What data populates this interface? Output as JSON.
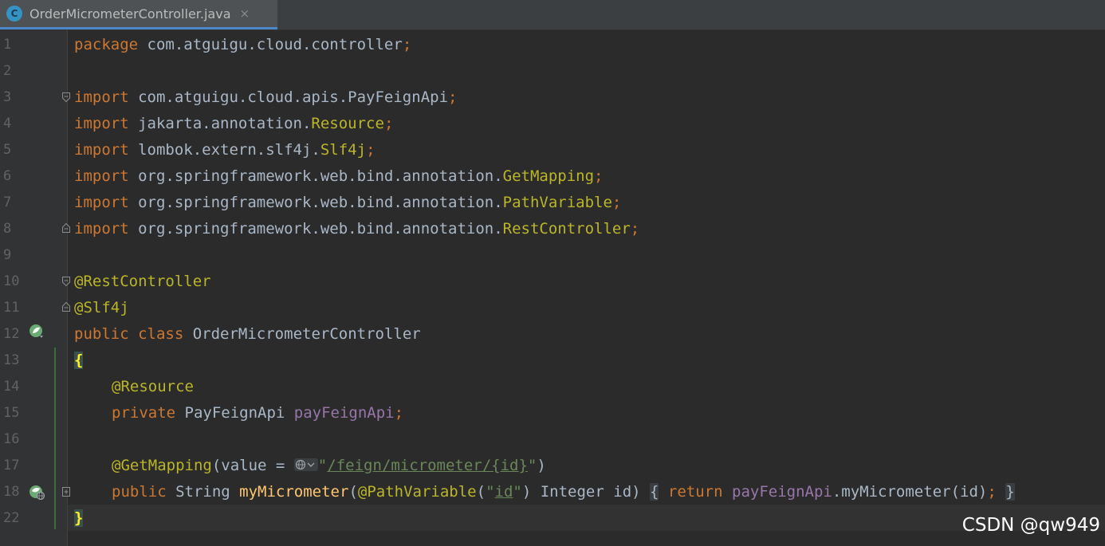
{
  "editor": {
    "tab": {
      "icon_letter": "C",
      "file_name": "OrderMicrometerController.java",
      "close_symbol": "×"
    },
    "lines": [
      {
        "num": "1",
        "t1": "package",
        "t2": " com.atguigu.cloud.controller",
        "t3": ";"
      },
      {
        "num": "2"
      },
      {
        "num": "3",
        "t1": "import",
        "t2": " com.atguigu.cloud.apis.PayFeignApi",
        "t3": ";"
      },
      {
        "num": "4",
        "t1": "import",
        "t2": " jakarta.annotation.",
        "t3": "Resource",
        "t4": ";"
      },
      {
        "num": "5",
        "t1": "import",
        "t2": " lombok.extern.slf4j.",
        "t3": "Slf4j",
        "t4": ";"
      },
      {
        "num": "6",
        "t1": "import",
        "t2": " org.springframework.web.bind.annotation.",
        "t3": "GetMapping",
        "t4": ";"
      },
      {
        "num": "7",
        "t1": "import",
        "t2": " org.springframework.web.bind.annotation.",
        "t3": "PathVariable",
        "t4": ";"
      },
      {
        "num": "8",
        "t1": "import",
        "t2": " org.springframework.web.bind.annotation.",
        "t3": "RestController",
        "t4": ";"
      },
      {
        "num": "9"
      },
      {
        "num": "10",
        "t1": "@RestController"
      },
      {
        "num": "11",
        "t1": "@Slf4j"
      },
      {
        "num": "12",
        "t1": "public",
        "t2": " ",
        "t3": "class",
        "t4": " OrderMicrometerController"
      },
      {
        "num": "13",
        "t1": "{"
      },
      {
        "num": "14",
        "t1": "@Resource"
      },
      {
        "num": "15",
        "t1": "private",
        "t2": " PayFeignApi ",
        "t3": "payFeignApi",
        "t4": ";"
      },
      {
        "num": "16"
      },
      {
        "num": "17",
        "t1": "@GetMapping",
        "t2": "(value = ",
        "t3": "\"",
        "t4": "/feign/micrometer/{id}",
        "t5": "\"",
        "t6": ")"
      },
      {
        "num": "18",
        "t1": "public",
        "t2": " String ",
        "t3": "myMicrometer",
        "t4": "(",
        "t5": "@PathVariable",
        "t6": "(",
        "t7": "\"",
        "t8": "id",
        "t9": "\"",
        "t10": ") Integer id) ",
        "t11": "{",
        "t12": " ",
        "t13": "return",
        "t14": " ",
        "t15": "payFeignApi",
        "t16": ".myMicrometer(id)",
        "t17": ";",
        "t18": " ",
        "t19": "}"
      },
      {
        "num": "22",
        "t1": "}"
      }
    ]
  },
  "colors": {
    "background": "#2b2b2b",
    "keyword": "#cc7832",
    "annotation": "#bbb529",
    "field": "#9876aa",
    "string": "#6a8759",
    "method": "#ffc66d",
    "text": "#a9b7c6"
  },
  "gutter_icons": [
    "spring-bean-icon",
    "fold-marker-icon",
    "web-endpoint-icon"
  ],
  "watermark": "CSDN @qw949"
}
